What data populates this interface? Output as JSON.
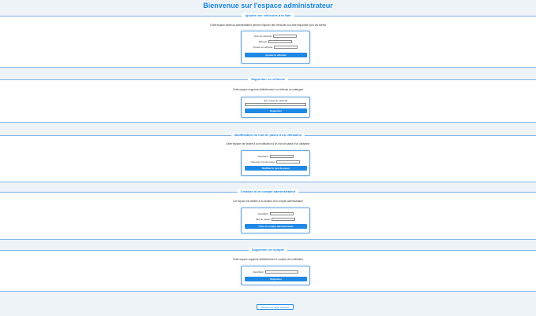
{
  "header": {
    "title": "Bienvenue sur l'espace administrateur"
  },
  "sections": {
    "add_vehicle": {
      "legend": "Ajouter une véhicules à la liste",
      "description": "Cette espace dédié au administrateur permet d'ajouter des véhicules à la liste disponible pour les clients",
      "fields": [
        "Nom du véhicule",
        "Marque",
        "Année du véhicule"
      ],
      "button": "Ajouter le véhicule"
    },
    "delete_vehicle": {
      "legend": "Supprimer un véhicule",
      "description": "Cette espace supprime définitivement un véhicule du catalogue",
      "field": "Nom exact du véhicule",
      "button": "Supprimer"
    },
    "change_password": {
      "legend": "Modification du mot de passe d'un utilisateur",
      "description": "Cette espace est dédiée à la modification d'un mot de passe d'un utilisateur",
      "fields": [
        "Identifiant",
        "Nouveau mot de passe"
      ],
      "button": "Modifier le mot de passe"
    },
    "create_admin": {
      "legend": "Création d'un compte administrateur",
      "description": "Cet espace est dédiée à la création d'un compte administrateur",
      "fields": [
        "Identifiant",
        "Mot de passe"
      ],
      "button": "Créer le compte administrateur"
    },
    "delete_account": {
      "legend": "Supprimer un compte",
      "description": "Cette espace supprime définitivement le compte d'un utilisateur",
      "field": "Identifiant",
      "button": "Supprimer"
    }
  },
  "footer": {
    "back_button": "Retour à la page d'accueil"
  }
}
